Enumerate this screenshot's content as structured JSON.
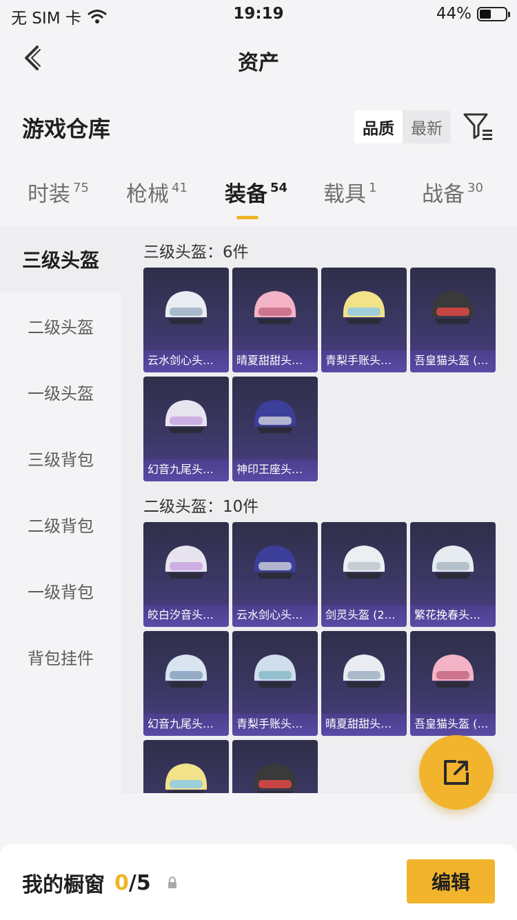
{
  "status": {
    "carrier": "无 SIM 卡",
    "time": "19:19",
    "battery": "44%",
    "battery_level": 0.44
  },
  "nav": {
    "title": "资产",
    "back_icon": "chevron-left-icon"
  },
  "header": {
    "title": "游戏仓库",
    "sort_options": [
      "品质",
      "最新"
    ],
    "sort_active": "品质",
    "filter_icon": "filter-list-icon"
  },
  "tabs": [
    {
      "label": "时装",
      "count": "75"
    },
    {
      "label": "枪械",
      "count": "41"
    },
    {
      "label": "装备",
      "count": "54"
    },
    {
      "label": "载具",
      "count": "1"
    },
    {
      "label": "战备",
      "count": "30"
    }
  ],
  "sidebar": [
    "三级头盔",
    "二级头盔",
    "一级头盔",
    "三级背包",
    "二级背包",
    "一级背包",
    "背包挂件"
  ],
  "sections": [
    {
      "title": "三级头盔：6件",
      "items": [
        "云水剑心头…",
        "晴夏甜甜头…",
        "青梨手账头…",
        "吾皇猫头盔 (…",
        "幻音九尾头…",
        "神印王座头…"
      ]
    },
    {
      "title": "二级头盔：10件",
      "items": [
        "皎白汐音头…",
        "云水剑心头…",
        "剑灵头盔 (2…",
        "繁花挽春头…",
        "幻音九尾头…",
        "青梨手账头…",
        "晴夏甜甜头…",
        "吾皇猫头盔 (…",
        "",
        ""
      ]
    }
  ],
  "footer": {
    "label": "我的橱窗",
    "count_current": "0",
    "count_total": "/5",
    "edit_label": "编辑"
  },
  "colors": {
    "accent": "#f2b42c",
    "card_top": "#2f2f4a",
    "card_bottom": "#4a3f86"
  }
}
